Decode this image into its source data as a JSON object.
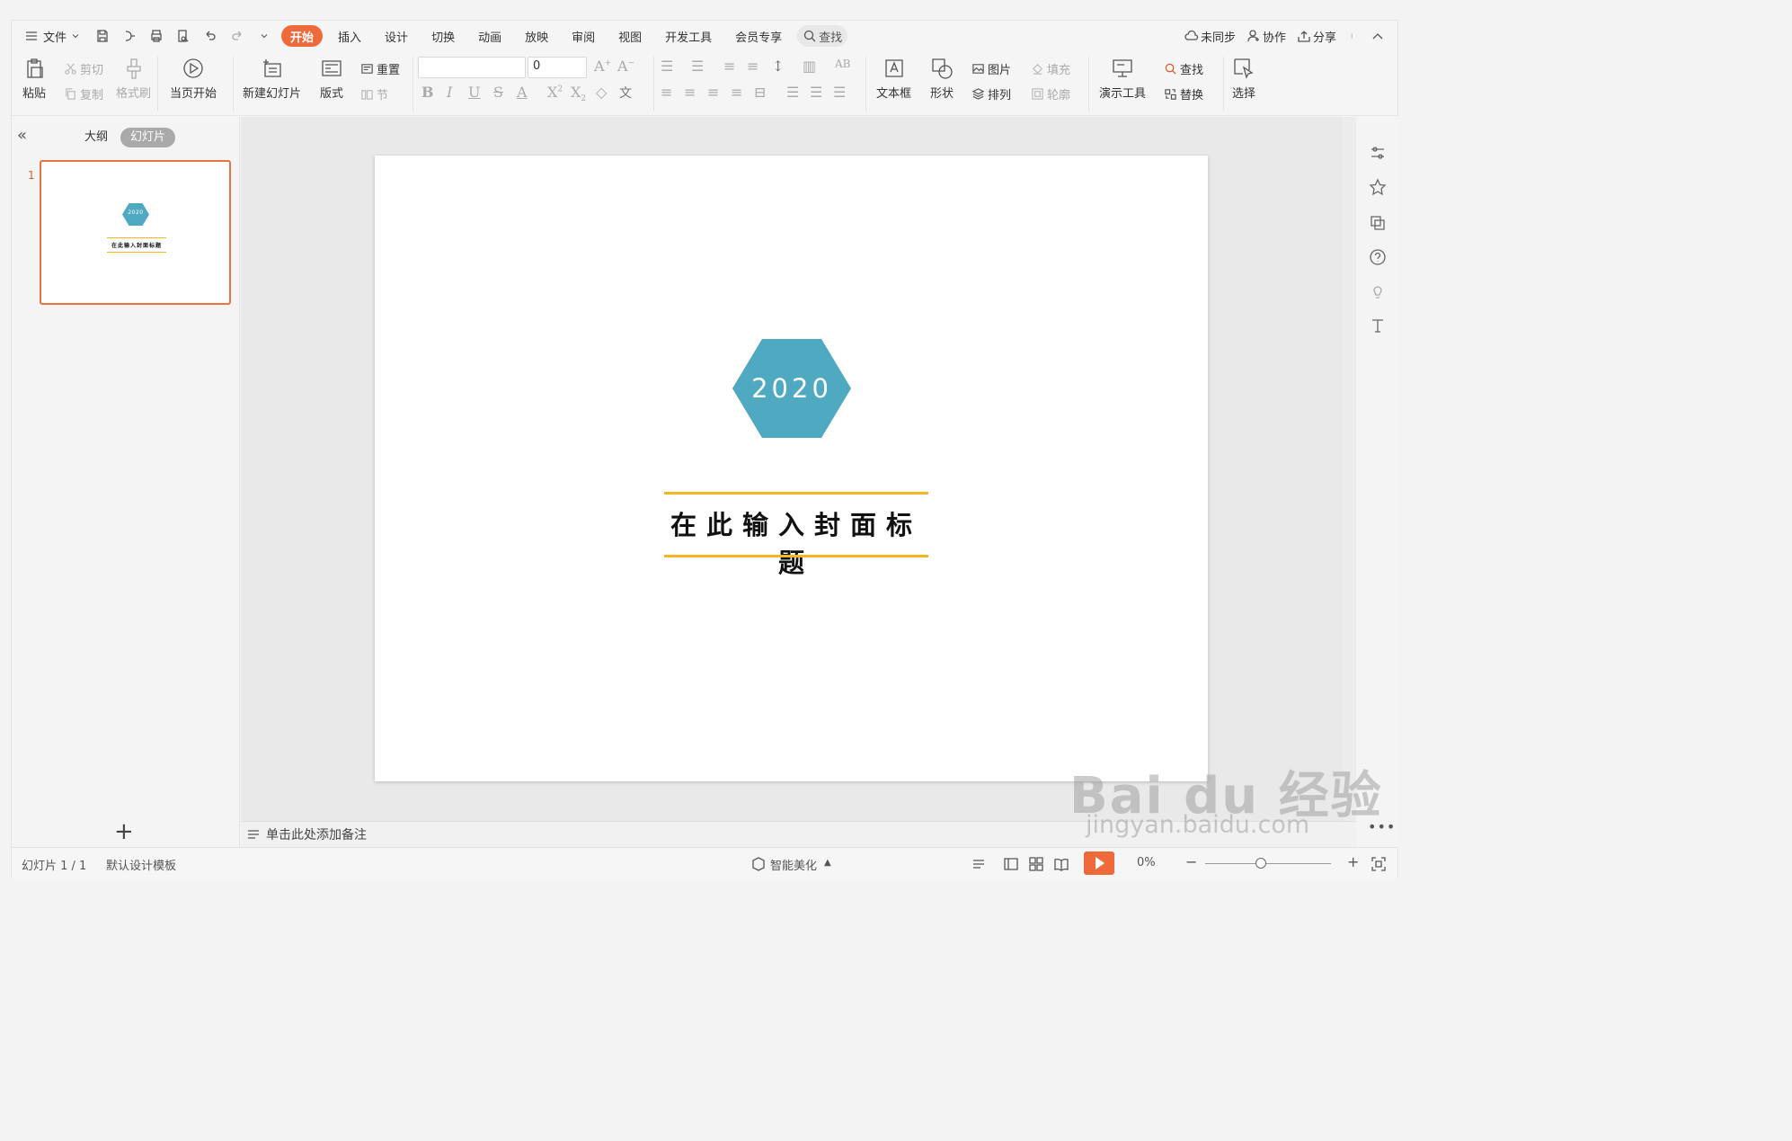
{
  "menubar": {
    "file_label": "文件",
    "tabs": [
      "开始",
      "插入",
      "设计",
      "切换",
      "动画",
      "放映",
      "审阅",
      "视图",
      "开发工具",
      "会员专享"
    ],
    "search_label": "查找",
    "right": {
      "sync": "未同步",
      "collab": "协作",
      "share": "分享"
    }
  },
  "ribbon": {
    "paste": "粘贴",
    "cut": "剪切",
    "copy": "复制",
    "format_painter": "格式刷",
    "play_from_current": "当页开始",
    "new_slide": "新建幻灯片",
    "layout": "版式",
    "reset": "重置",
    "section": "节",
    "font_name": "",
    "font_size": "0",
    "textbox": "文本框",
    "shape": "形状",
    "picture": "图片",
    "fill": "填充",
    "arrange": "排列",
    "outline": "轮廓",
    "present_tools": "演示工具",
    "find": "查找",
    "replace": "替换",
    "select": "选择"
  },
  "left_panel": {
    "outline_tab": "大纲",
    "slides_tab": "幻灯片",
    "slide_number": "1",
    "thumb_year": "2020",
    "thumb_title": "在此输入封面标题"
  },
  "slide": {
    "year": "2020",
    "title": "在此输入封面标题",
    "hex_color": "#4fa9c0",
    "line_color": "#f2b824"
  },
  "notes_placeholder": "单击此处添加备注",
  "status": {
    "slide_counter": "幻灯片 1 / 1",
    "template": "默认设计模板",
    "beautify": "智能美化",
    "zoom": "0%"
  },
  "watermark": {
    "brand": "Bai du 经验",
    "url": "jingyan.baidu.com"
  },
  "colors": {
    "accent": "#ee6a3b",
    "thumb_border": "#e8743f"
  }
}
